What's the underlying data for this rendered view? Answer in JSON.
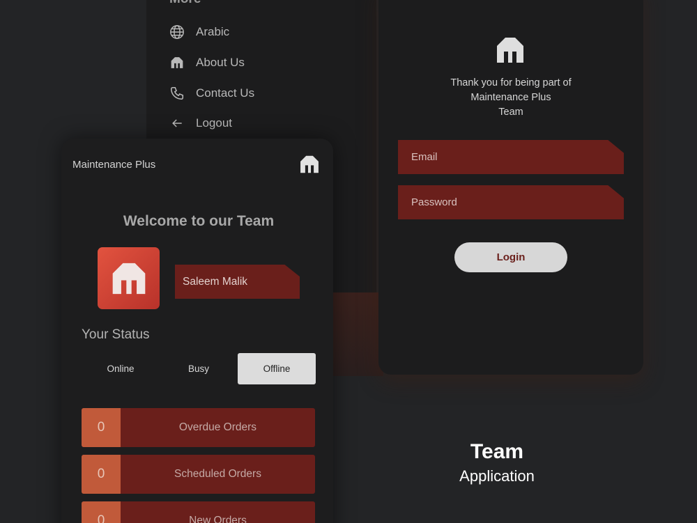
{
  "menu": {
    "title": "More",
    "items": [
      {
        "label": "Arabic",
        "icon": "globe-icon"
      },
      {
        "label": "About Us",
        "icon": "brand-logo-icon"
      },
      {
        "label": "Contact Us",
        "icon": "phone-icon"
      },
      {
        "label": "Logout",
        "icon": "arrow-left-icon"
      }
    ]
  },
  "login": {
    "thanks_lines": [
      "Thank you for being part of",
      "Maintenance Plus",
      "Team"
    ],
    "email_placeholder": "Email",
    "password_placeholder": "Password",
    "login_label": "Login"
  },
  "dashboard": {
    "app_title": "Maintenance Plus",
    "welcome": "Welcome to our Team",
    "user_name": "Saleem Malik",
    "status_label": "Your Status",
    "status_options": [
      "Online",
      "Busy",
      "Offline"
    ],
    "selected_status": "Offline",
    "orders": [
      {
        "count": "0",
        "label": "Overdue Orders"
      },
      {
        "count": "0",
        "label": "Scheduled Orders"
      },
      {
        "count": "0",
        "label": "New Orders"
      }
    ]
  },
  "caption": {
    "title": "Team",
    "subtitle": "Application"
  },
  "colors": {
    "background": "#232426",
    "panel": "#1c1c1d",
    "accent_dark_red": "#6a1f1b",
    "accent_orange": "#c15a3a",
    "logo_red": "#d8453a"
  }
}
